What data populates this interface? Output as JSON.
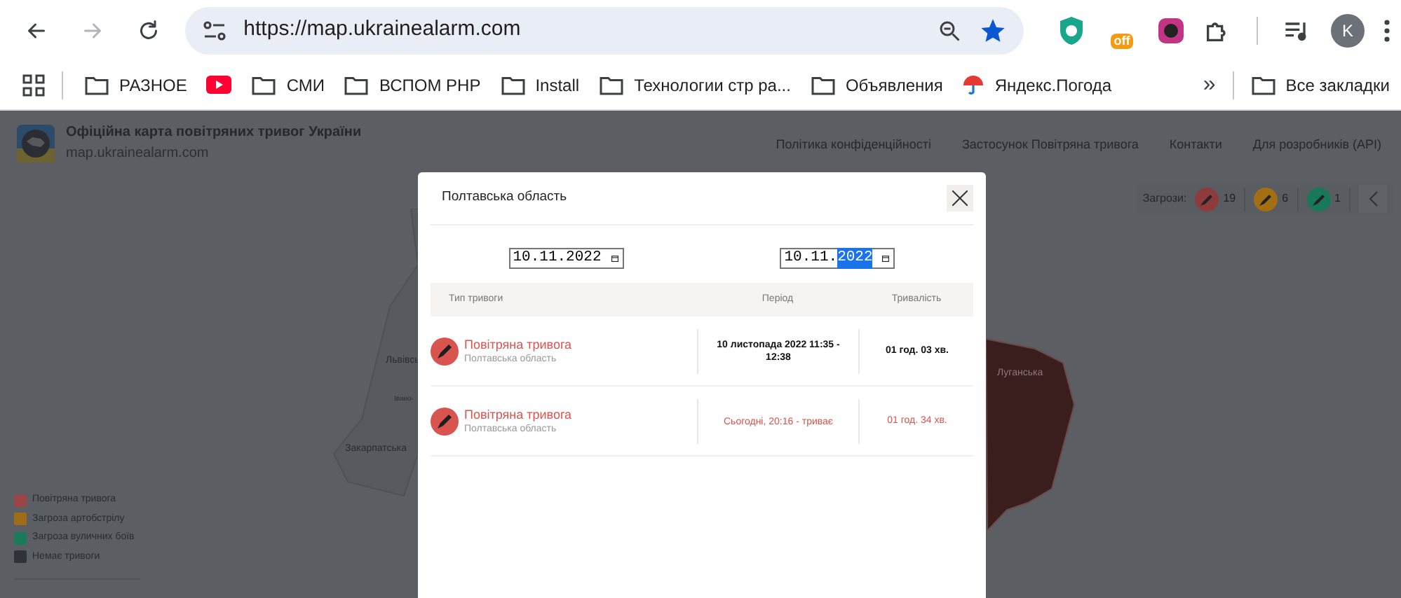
{
  "browser": {
    "nav_buttons": [
      {
        "kind": "back",
        "disabled": false
      },
      {
        "kind": "forward",
        "disabled": true
      },
      {
        "kind": "reload",
        "disabled": false
      }
    ],
    "url": "https://map.ukrainealarm.com",
    "extension_badge": "off",
    "avatar": "K",
    "bookmarks": [
      {
        "kind": "folder",
        "label": "РАЗНОЕ"
      },
      {
        "kind": "video"
      },
      {
        "kind": "folder",
        "label": "СМИ"
      },
      {
        "kind": "folder",
        "label": "ВСПОМ PHP"
      },
      {
        "kind": "folder",
        "label": "Install"
      },
      {
        "kind": "folder",
        "label": "Технологии стр ра..."
      },
      {
        "kind": "folder",
        "label": "Объявления"
      },
      {
        "kind": "umbrella",
        "label": "Яндекс.Погода"
      }
    ],
    "more": "»",
    "all_bookmarks": "Все закладки"
  },
  "site": {
    "title": "Офіційна карта повітряних тривог України",
    "subtitle": "map.ukrainealarm.com",
    "nav": [
      "Політика конфіденційності",
      "Застосунок Повітряна тривога",
      "Контакти",
      "Для розробників (API)"
    ],
    "threats": {
      "label": "Загрози:",
      "items": [
        {
          "color": "#8e3b3b",
          "count": "19"
        },
        {
          "color": "#a36f12",
          "count": "6"
        },
        {
          "color": "#17795a",
          "count": "1"
        }
      ]
    },
    "map_labels": [
      "Львівсь",
      "Івано-",
      "Закарпатська",
      "Луганська"
    ],
    "legend": [
      {
        "color": "#9a4646",
        "label": "Повітряна тривога"
      },
      {
        "color": "#a06c18",
        "label": "Загроза артобстрілу"
      },
      {
        "color": "#197a5c",
        "label": "Загроза вуличних боїв"
      },
      {
        "color": "#2d323b",
        "label": "Немає тривоги"
      }
    ]
  },
  "modal": {
    "title": "Полтавська область",
    "dates": [
      {
        "segments": [
          {
            "text": "10.11.2022",
            "selected": false
          }
        ]
      },
      {
        "segments": [
          {
            "text": "10.11.",
            "selected": false
          },
          {
            "text": "2022",
            "selected": true
          }
        ]
      }
    ],
    "columns": [
      "Тип тривоги",
      "Період",
      "Тривалість"
    ],
    "rows": [
      {
        "title": "Повітряна тривога",
        "subtitle": "Полтавська область",
        "period": "10 листопада 2022 11:35 - 12:38",
        "duration": "01 год. 03 хв.",
        "ongoing": false
      },
      {
        "title": "Повітряна тривога",
        "subtitle": "Полтавська область",
        "period": "Сьогодні, 20:16 - триває",
        "duration": "01 год. 34 хв.",
        "ongoing": true
      }
    ]
  }
}
